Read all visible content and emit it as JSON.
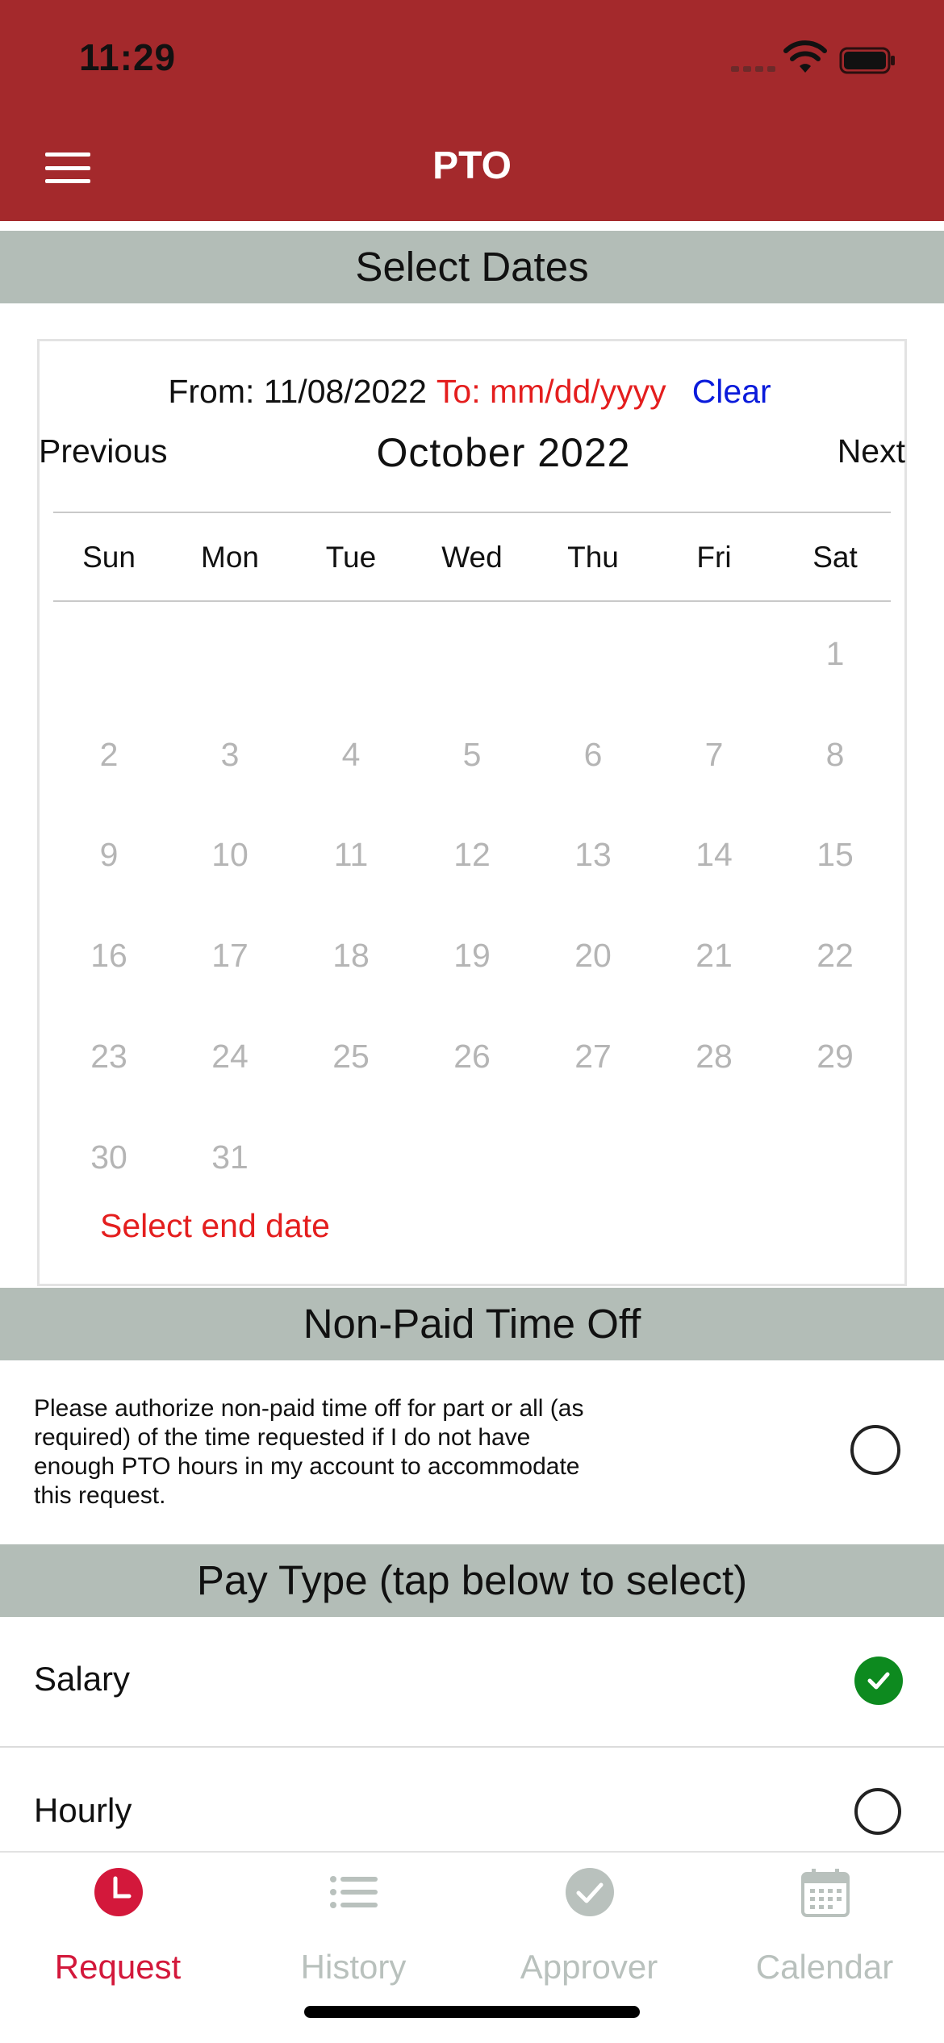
{
  "status_bar": {
    "time": "11:29"
  },
  "nav": {
    "title": "PTO",
    "menu_icon": "hamburger-menu-icon"
  },
  "select_dates": {
    "header": "Select Dates",
    "from_text": "From: 11/08/2022",
    "to_text": "To: mm/dd/yyyy",
    "clear_label": "Clear",
    "previous_label": "Previous",
    "next_label": "Next",
    "month_title": "October 2022",
    "weekdays": [
      "Sun",
      "Mon",
      "Tue",
      "Wed",
      "Thu",
      "Fri",
      "Sat"
    ],
    "weeks": [
      [
        "",
        "",
        "",
        "",
        "",
        "",
        "1"
      ],
      [
        "2",
        "3",
        "4",
        "5",
        "6",
        "7",
        "8"
      ],
      [
        "9",
        "10",
        "11",
        "12",
        "13",
        "14",
        "15"
      ],
      [
        "16",
        "17",
        "18",
        "19",
        "20",
        "21",
        "22"
      ],
      [
        "23",
        "24",
        "25",
        "26",
        "27",
        "28",
        "29"
      ],
      [
        "30",
        "31",
        "",
        "",
        "",
        "",
        ""
      ]
    ],
    "hint": "Select end date"
  },
  "non_paid": {
    "header": "Non-Paid Time Off",
    "text": "Please authorize non-paid time off for part or all (as required) of the time requested if I do not have enough PTO hours in my account to accommodate this request.",
    "checked": false
  },
  "pay_type": {
    "header": "Pay Type (tap below to select)",
    "options": [
      {
        "label": "Salary",
        "selected": true
      },
      {
        "label": "Hourly",
        "selected": false
      }
    ]
  },
  "tabs": [
    {
      "label": "Request",
      "icon": "clock-icon",
      "active": true
    },
    {
      "label": "History",
      "icon": "list-icon",
      "active": false
    },
    {
      "label": "Approver",
      "icon": "checkmark-circle-icon",
      "active": false
    },
    {
      "label": "Calendar",
      "icon": "calendar-icon",
      "active": false
    }
  ],
  "colors": {
    "brand_red": "#a4292c",
    "section_gray": "#b3bdb7",
    "active_tab": "#d3183b",
    "inactive_tab": "#b9c1bd",
    "alert_red": "#e41e1e",
    "link_blue": "#0a1bdb",
    "check_green": "#0d8a1f"
  }
}
